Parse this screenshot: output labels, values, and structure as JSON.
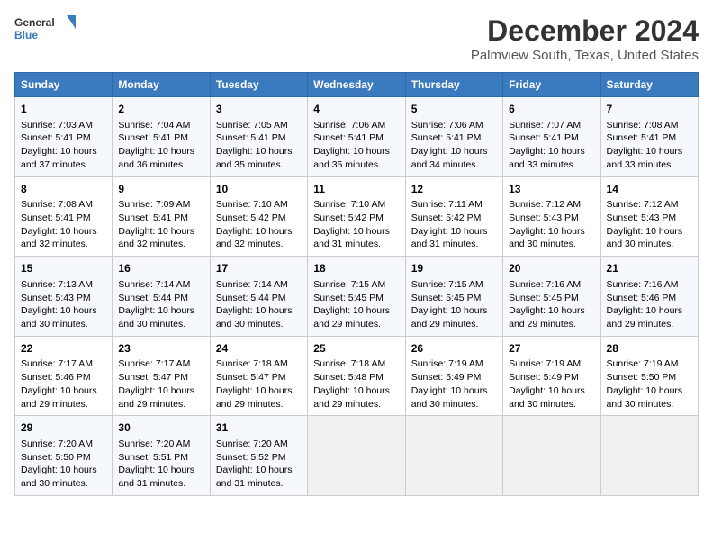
{
  "header": {
    "logo_line1": "General",
    "logo_line2": "Blue",
    "month_title": "December 2024",
    "location": "Palmview South, Texas, United States"
  },
  "days_of_week": [
    "Sunday",
    "Monday",
    "Tuesday",
    "Wednesday",
    "Thursday",
    "Friday",
    "Saturday"
  ],
  "weeks": [
    [
      {
        "day": 1,
        "lines": [
          "Sunrise: 7:03 AM",
          "Sunset: 5:41 PM",
          "Daylight: 10 hours",
          "and 37 minutes."
        ]
      },
      {
        "day": 2,
        "lines": [
          "Sunrise: 7:04 AM",
          "Sunset: 5:41 PM",
          "Daylight: 10 hours",
          "and 36 minutes."
        ]
      },
      {
        "day": 3,
        "lines": [
          "Sunrise: 7:05 AM",
          "Sunset: 5:41 PM",
          "Daylight: 10 hours",
          "and 35 minutes."
        ]
      },
      {
        "day": 4,
        "lines": [
          "Sunrise: 7:06 AM",
          "Sunset: 5:41 PM",
          "Daylight: 10 hours",
          "and 35 minutes."
        ]
      },
      {
        "day": 5,
        "lines": [
          "Sunrise: 7:06 AM",
          "Sunset: 5:41 PM",
          "Daylight: 10 hours",
          "and 34 minutes."
        ]
      },
      {
        "day": 6,
        "lines": [
          "Sunrise: 7:07 AM",
          "Sunset: 5:41 PM",
          "Daylight: 10 hours",
          "and 33 minutes."
        ]
      },
      {
        "day": 7,
        "lines": [
          "Sunrise: 7:08 AM",
          "Sunset: 5:41 PM",
          "Daylight: 10 hours",
          "and 33 minutes."
        ]
      }
    ],
    [
      {
        "day": 8,
        "lines": [
          "Sunrise: 7:08 AM",
          "Sunset: 5:41 PM",
          "Daylight: 10 hours",
          "and 32 minutes."
        ]
      },
      {
        "day": 9,
        "lines": [
          "Sunrise: 7:09 AM",
          "Sunset: 5:41 PM",
          "Daylight: 10 hours",
          "and 32 minutes."
        ]
      },
      {
        "day": 10,
        "lines": [
          "Sunrise: 7:10 AM",
          "Sunset: 5:42 PM",
          "Daylight: 10 hours",
          "and 32 minutes."
        ]
      },
      {
        "day": 11,
        "lines": [
          "Sunrise: 7:10 AM",
          "Sunset: 5:42 PM",
          "Daylight: 10 hours",
          "and 31 minutes."
        ]
      },
      {
        "day": 12,
        "lines": [
          "Sunrise: 7:11 AM",
          "Sunset: 5:42 PM",
          "Daylight: 10 hours",
          "and 31 minutes."
        ]
      },
      {
        "day": 13,
        "lines": [
          "Sunrise: 7:12 AM",
          "Sunset: 5:43 PM",
          "Daylight: 10 hours",
          "and 30 minutes."
        ]
      },
      {
        "day": 14,
        "lines": [
          "Sunrise: 7:12 AM",
          "Sunset: 5:43 PM",
          "Daylight: 10 hours",
          "and 30 minutes."
        ]
      }
    ],
    [
      {
        "day": 15,
        "lines": [
          "Sunrise: 7:13 AM",
          "Sunset: 5:43 PM",
          "Daylight: 10 hours",
          "and 30 minutes."
        ]
      },
      {
        "day": 16,
        "lines": [
          "Sunrise: 7:14 AM",
          "Sunset: 5:44 PM",
          "Daylight: 10 hours",
          "and 30 minutes."
        ]
      },
      {
        "day": 17,
        "lines": [
          "Sunrise: 7:14 AM",
          "Sunset: 5:44 PM",
          "Daylight: 10 hours",
          "and 30 minutes."
        ]
      },
      {
        "day": 18,
        "lines": [
          "Sunrise: 7:15 AM",
          "Sunset: 5:45 PM",
          "Daylight: 10 hours",
          "and 29 minutes."
        ]
      },
      {
        "day": 19,
        "lines": [
          "Sunrise: 7:15 AM",
          "Sunset: 5:45 PM",
          "Daylight: 10 hours",
          "and 29 minutes."
        ]
      },
      {
        "day": 20,
        "lines": [
          "Sunrise: 7:16 AM",
          "Sunset: 5:45 PM",
          "Daylight: 10 hours",
          "and 29 minutes."
        ]
      },
      {
        "day": 21,
        "lines": [
          "Sunrise: 7:16 AM",
          "Sunset: 5:46 PM",
          "Daylight: 10 hours",
          "and 29 minutes."
        ]
      }
    ],
    [
      {
        "day": 22,
        "lines": [
          "Sunrise: 7:17 AM",
          "Sunset: 5:46 PM",
          "Daylight: 10 hours",
          "and 29 minutes."
        ]
      },
      {
        "day": 23,
        "lines": [
          "Sunrise: 7:17 AM",
          "Sunset: 5:47 PM",
          "Daylight: 10 hours",
          "and 29 minutes."
        ]
      },
      {
        "day": 24,
        "lines": [
          "Sunrise: 7:18 AM",
          "Sunset: 5:47 PM",
          "Daylight: 10 hours",
          "and 29 minutes."
        ]
      },
      {
        "day": 25,
        "lines": [
          "Sunrise: 7:18 AM",
          "Sunset: 5:48 PM",
          "Daylight: 10 hours",
          "and 29 minutes."
        ]
      },
      {
        "day": 26,
        "lines": [
          "Sunrise: 7:19 AM",
          "Sunset: 5:49 PM",
          "Daylight: 10 hours",
          "and 30 minutes."
        ]
      },
      {
        "day": 27,
        "lines": [
          "Sunrise: 7:19 AM",
          "Sunset: 5:49 PM",
          "Daylight: 10 hours",
          "and 30 minutes."
        ]
      },
      {
        "day": 28,
        "lines": [
          "Sunrise: 7:19 AM",
          "Sunset: 5:50 PM",
          "Daylight: 10 hours",
          "and 30 minutes."
        ]
      }
    ],
    [
      {
        "day": 29,
        "lines": [
          "Sunrise: 7:20 AM",
          "Sunset: 5:50 PM",
          "Daylight: 10 hours",
          "and 30 minutes."
        ]
      },
      {
        "day": 30,
        "lines": [
          "Sunrise: 7:20 AM",
          "Sunset: 5:51 PM",
          "Daylight: 10 hours",
          "and 31 minutes."
        ]
      },
      {
        "day": 31,
        "lines": [
          "Sunrise: 7:20 AM",
          "Sunset: 5:52 PM",
          "Daylight: 10 hours",
          "and 31 minutes."
        ]
      },
      null,
      null,
      null,
      null
    ]
  ]
}
